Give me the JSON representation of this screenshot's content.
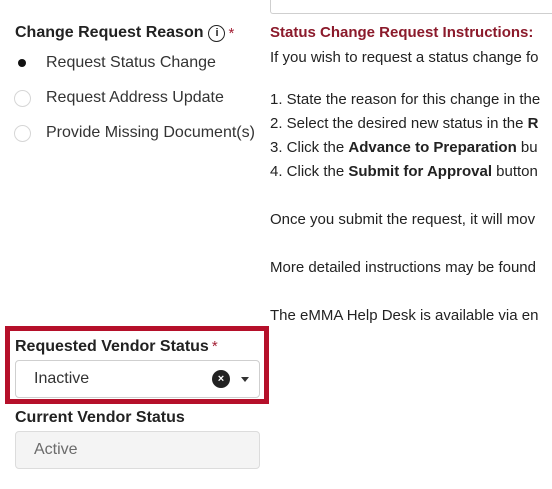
{
  "reason": {
    "label": "Change Request Reason",
    "info_glyph": "i",
    "required_mark": "*",
    "options": [
      {
        "label": "Request Status Change",
        "selected": true
      },
      {
        "label": "Request Address Update",
        "selected": false
      },
      {
        "label": "Provide Missing Document(s)",
        "selected": false
      }
    ]
  },
  "instructions": {
    "title": "Status Change Request Instructions:",
    "intro": "If you wish to request a status change fo",
    "step1": "1. State the reason for this change in the",
    "step2_prefix": "2. Select the desired new status in the ",
    "step2_bold": "R",
    "step3_prefix": "3. Click the ",
    "step3_bold": "Advance to Preparation",
    "step3_suffix": " bu",
    "step4_prefix": "4. Click the ",
    "step4_bold": "Submit for Approval",
    "step4_suffix": " button",
    "submit_note": "Once you submit the request, it will mov",
    "more_info": "More detailed instructions may be found",
    "helpdesk": "The eMMA Help Desk is available via en"
  },
  "requested_status": {
    "label": "Requested Vendor Status",
    "required_mark": "*",
    "value": "Inactive",
    "clear_glyph": "×",
    "icons": [
      "clear-icon",
      "caret-down-icon"
    ]
  },
  "current_status": {
    "label": "Current Vendor Status",
    "value": "Active"
  },
  "colors": {
    "accent": "#8b1a2b",
    "highlight": "#b5102a"
  }
}
